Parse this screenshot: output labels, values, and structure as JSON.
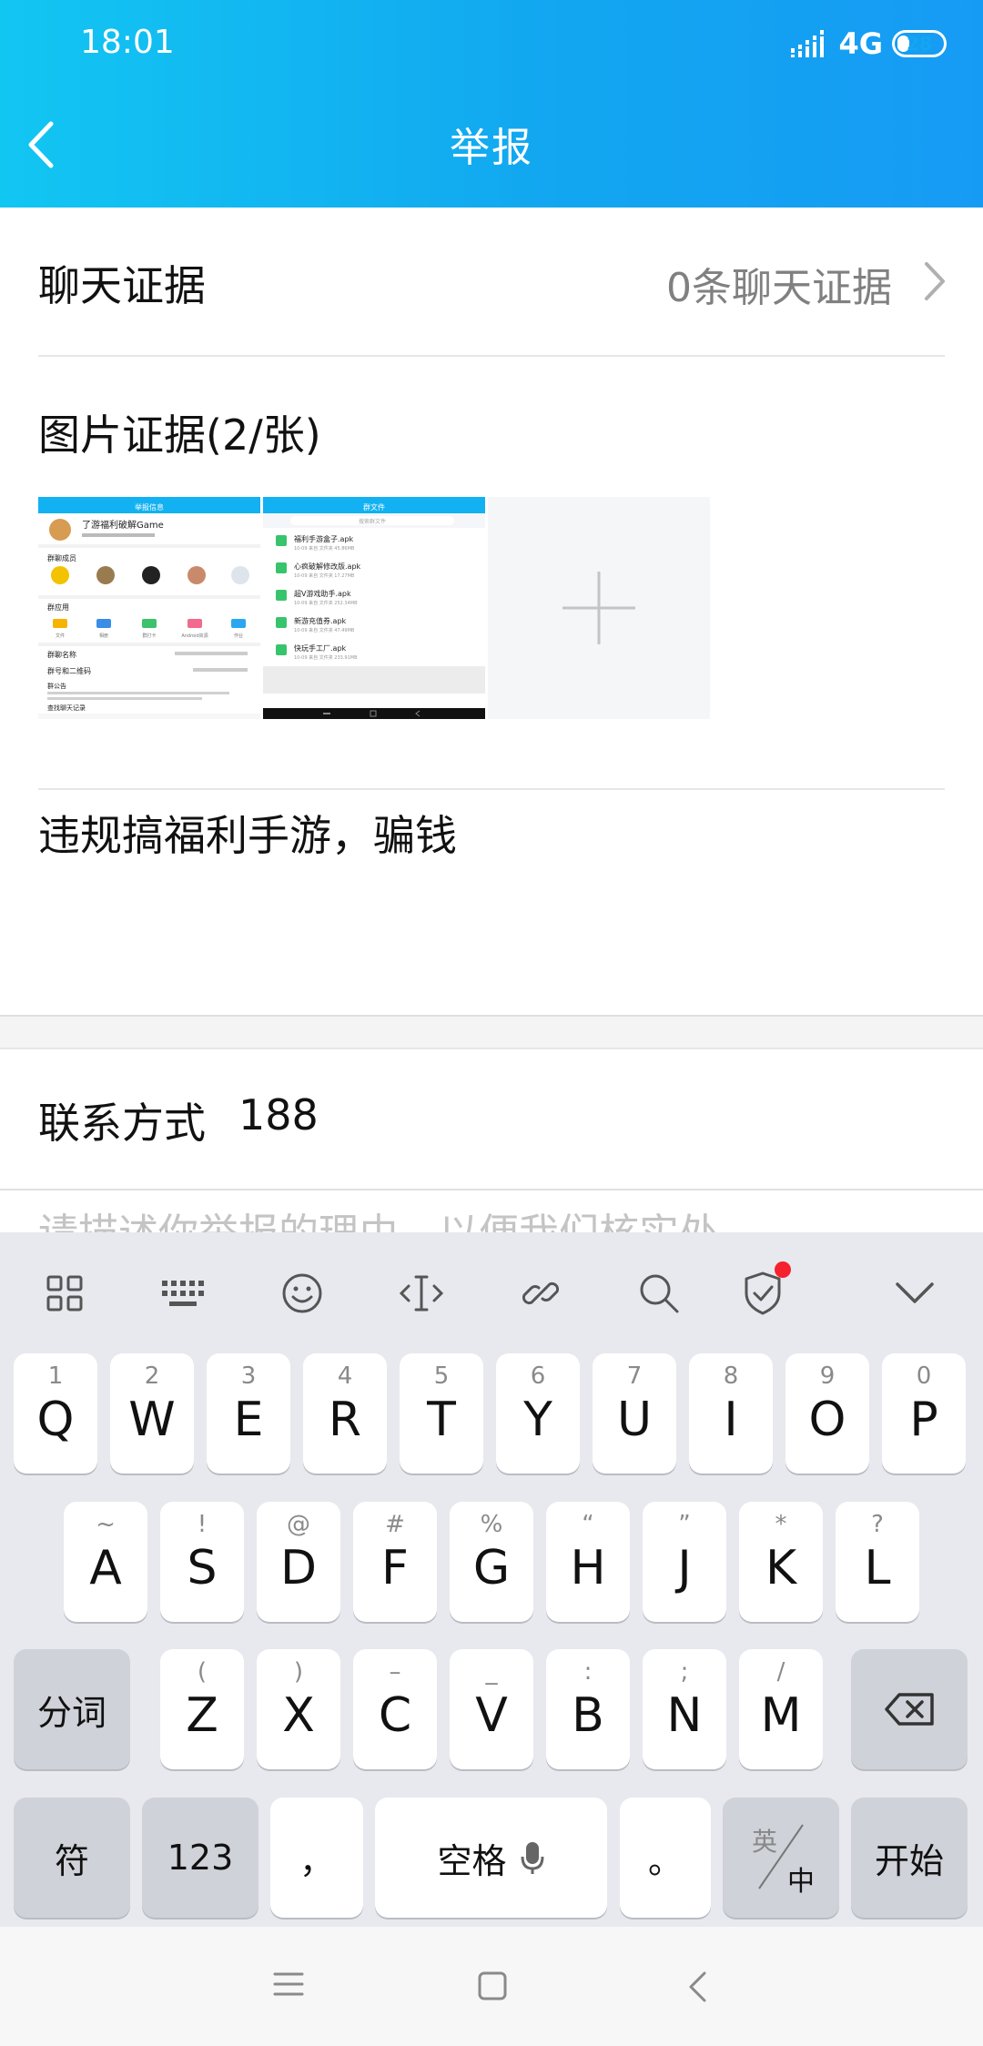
{
  "status_bar": {
    "time": "18:01",
    "network": "4G",
    "battery": "28",
    "battery_level": 0.28
  },
  "header": {
    "title": "举报"
  },
  "form": {
    "chat_evidence": {
      "label": "聊天证据",
      "value": "0条聊天证据"
    },
    "image_evidence": {
      "label": "图片证据(2/张)"
    },
    "thumbs": [
      {
        "top_title": "举报信息",
        "name": "了游福利破解Game",
        "sections": [
          "群聊成员",
          "群应用",
          "群聊名称",
          "群号和二维码",
          "群公告"
        ],
        "apps": [
          "文件",
          "相册",
          "群打卡",
          "Android资源",
          "作业"
        ],
        "footer": "查找聊天记录"
      },
      {
        "top_title": "群文件",
        "search": "搜索群文件",
        "files": [
          {
            "name": "福利手游盒子.apk",
            "meta": "10-09 来自 文件夹 45.86MB"
          },
          {
            "name": "心疯破解修改版.apk",
            "meta": "10-09 来自 文件夹 17.27MB"
          },
          {
            "name": "超V游戏助手.apk",
            "meta": "10-09 来自 文件夹 252.34MB"
          },
          {
            "name": "新游充值券.apk",
            "meta": "10-09 来自 文件夹 47.49MB"
          },
          {
            "name": "快玩手工厂.apk",
            "meta": "10-09 来自 文件夹 233.91MB"
          }
        ]
      }
    ],
    "description": "违规搞福利手游，骗钱",
    "contact": {
      "label": "联系方式",
      "value": "188"
    },
    "hint_peek": "请描述你举报的理由，以便我们核实处理"
  },
  "keyboard": {
    "row1": [
      {
        "main": "Q",
        "sub": "1"
      },
      {
        "main": "W",
        "sub": "2"
      },
      {
        "main": "E",
        "sub": "3"
      },
      {
        "main": "R",
        "sub": "4"
      },
      {
        "main": "T",
        "sub": "5"
      },
      {
        "main": "Y",
        "sub": "6"
      },
      {
        "main": "U",
        "sub": "7"
      },
      {
        "main": "I",
        "sub": "8"
      },
      {
        "main": "O",
        "sub": "9"
      },
      {
        "main": "P",
        "sub": "0"
      }
    ],
    "row2": [
      {
        "main": "A",
        "sub": "~"
      },
      {
        "main": "S",
        "sub": "!"
      },
      {
        "main": "D",
        "sub": "@"
      },
      {
        "main": "F",
        "sub": "#"
      },
      {
        "main": "G",
        "sub": "%"
      },
      {
        "main": "H",
        "sub": "“"
      },
      {
        "main": "J",
        "sub": "”"
      },
      {
        "main": "K",
        "sub": "*"
      },
      {
        "main": "L",
        "sub": "?"
      }
    ],
    "row3": [
      {
        "main": "Z",
        "sub": "("
      },
      {
        "main": "X",
        "sub": ")"
      },
      {
        "main": "C",
        "sub": "–"
      },
      {
        "main": "V",
        "sub": "_"
      },
      {
        "main": "B",
        "sub": ":"
      },
      {
        "main": "N",
        "sub": ";"
      },
      {
        "main": "M",
        "sub": "/"
      }
    ],
    "fenci": "分词",
    "fu": "符",
    "num": "123",
    "comma": "，",
    "space": "空格",
    "period": "。",
    "lang_en": "英",
    "lang_zh": "中",
    "go": "开始"
  }
}
